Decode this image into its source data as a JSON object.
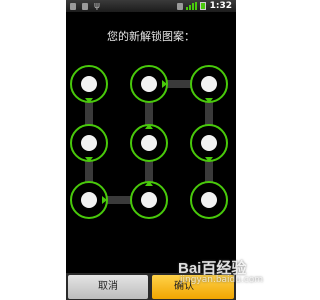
{
  "status_bar": {
    "time": "1:32",
    "icons": [
      "notification-icon",
      "notification-icon",
      "usb-icon",
      "signal-icon",
      "battery-icon"
    ],
    "accent_color": "#49c90b"
  },
  "screen": {
    "prompt": "您的新解锁图案："
  },
  "pattern": {
    "rows": 3,
    "cols": 3,
    "selected_color": "#49c90b",
    "sequence": [
      "row1-col1",
      "row2-col1",
      "row3-col1",
      "row3-col2",
      "row2-col2",
      "row1-col2",
      "row1-col3",
      "row2-col3",
      "row3-col3"
    ]
  },
  "buttons": {
    "cancel_label": "取消",
    "confirm_label": "确认"
  },
  "watermark": {
    "text": "Bai百经验",
    "sub": "jingyan.baidu.com"
  }
}
